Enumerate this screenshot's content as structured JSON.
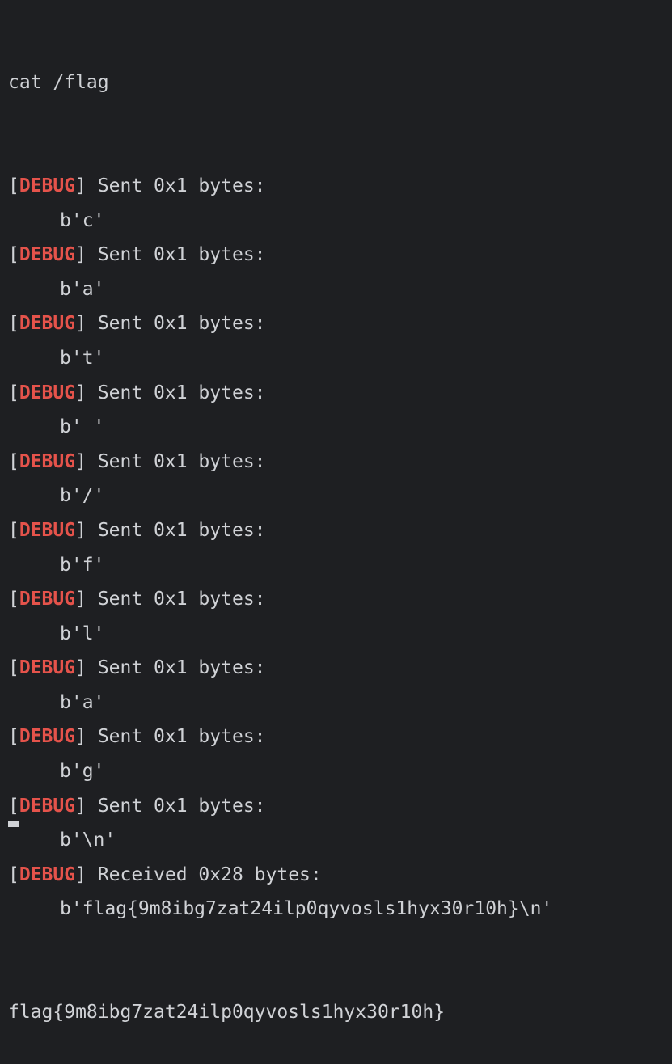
{
  "terminal": {
    "command": "cat /flag",
    "debug_tag": "DEBUG",
    "entries": [
      {
        "message": "Sent 0x1 bytes:",
        "payload": "b'c'"
      },
      {
        "message": "Sent 0x1 bytes:",
        "payload": "b'a'"
      },
      {
        "message": "Sent 0x1 bytes:",
        "payload": "b't'"
      },
      {
        "message": "Sent 0x1 bytes:",
        "payload": "b' '"
      },
      {
        "message": "Sent 0x1 bytes:",
        "payload": "b'/'"
      },
      {
        "message": "Sent 0x1 bytes:",
        "payload": "b'f'"
      },
      {
        "message": "Sent 0x1 bytes:",
        "payload": "b'l'"
      },
      {
        "message": "Sent 0x1 bytes:",
        "payload": "b'a'"
      },
      {
        "message": "Sent 0x1 bytes:",
        "payload": "b'g'"
      },
      {
        "message": "Sent 0x1 bytes:",
        "payload": "b'\\n'"
      },
      {
        "message": "Received 0x28 bytes:",
        "payload": "b'flag{9m8ibg7zat24ilp0qyvosls1hyx30r10h}\\n'"
      }
    ],
    "output": "flag{9m8ibg7zat24ilp0qyvosls1hyx30r10h}"
  },
  "colors": {
    "background": "#1e1f22",
    "text": "#d0d2d6",
    "debug_accent": "#e5534b"
  }
}
